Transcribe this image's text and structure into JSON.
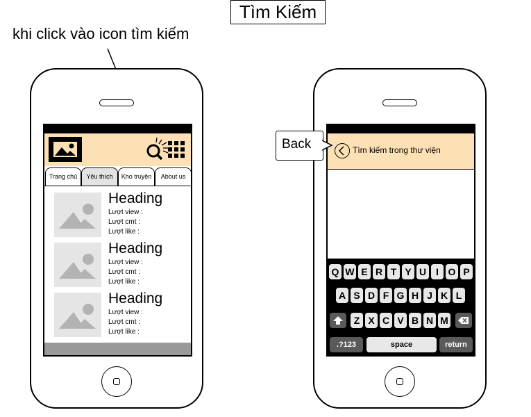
{
  "page": {
    "title": "Tìm Kiếm",
    "annotation": "khi click vào icon tìm kiếm"
  },
  "left_phone": {
    "tabs": [
      {
        "label": "Trang chủ",
        "active": false
      },
      {
        "label": "Yêu thích",
        "active": true
      },
      {
        "label": "Kho truyện",
        "active": false
      },
      {
        "label": "About us",
        "active": false
      }
    ],
    "items": [
      {
        "heading": "Heading",
        "view": "Lượt view :",
        "cmt": "Lượt cmt :",
        "like": "Lượt like :"
      },
      {
        "heading": "Heading",
        "view": "Lượt view :",
        "cmt": "Lượt cmt :",
        "like": "Lượt like :"
      },
      {
        "heading": "Heading",
        "view": "Lượt view :",
        "cmt": "Lượt cmt :",
        "like": "Lượt like :"
      }
    ],
    "icons": [
      "image-icon",
      "search-icon",
      "grid-menu-icon",
      "image-placeholder-icon"
    ]
  },
  "right_phone": {
    "search_label": "Tìm kiếm trong thư viện",
    "callout": "Back",
    "keyboard": {
      "row1": [
        "Q",
        "W",
        "E",
        "R",
        "T",
        "Y",
        "U",
        "I",
        "O",
        "P"
      ],
      "row2": [
        "A",
        "S",
        "D",
        "F",
        "G",
        "H",
        "J",
        "K",
        "L"
      ],
      "row3": [
        "Z",
        "X",
        "C",
        "V",
        "B",
        "N",
        "M"
      ],
      "numbers_key": ".?123",
      "space_key": "space",
      "return_key": "return"
    },
    "icons": [
      "back-arrow-icon",
      "shift-icon",
      "delete-icon"
    ]
  },
  "colors": {
    "header_bg": "#fde0b4",
    "thumb_bg": "#e5e5e5",
    "bottom_bar": "#999999",
    "tab_active": "#e3e3e3"
  }
}
